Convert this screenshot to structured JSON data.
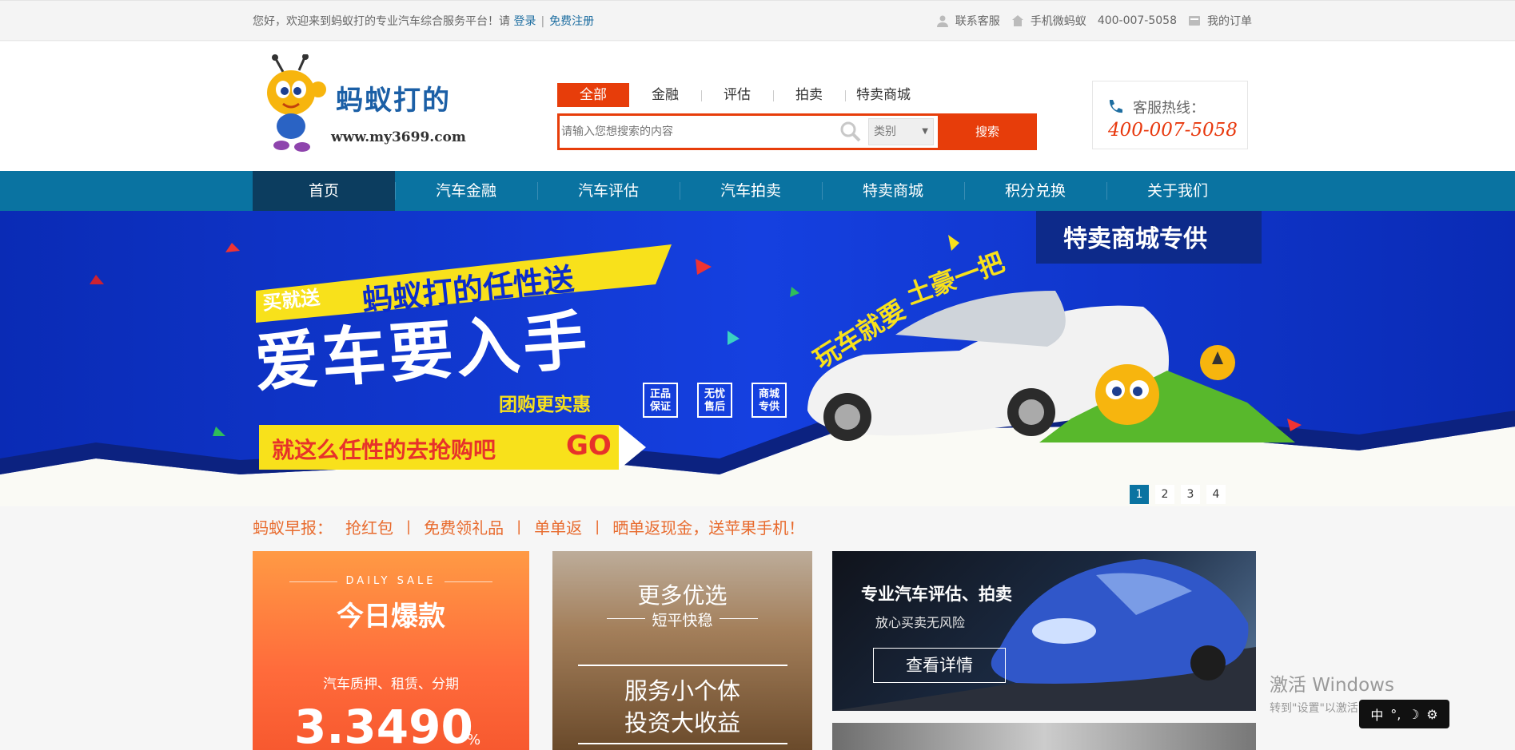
{
  "topbar": {
    "welcome": "您好，欢迎来到蚂蚁打的专业汽车综合服务平台！请",
    "login": "登录",
    "register": "免费注册",
    "service": "联系客服",
    "mobile": "手机微蚂蚁",
    "phone": "400-007-5058",
    "orders": "我的订单"
  },
  "logo": {
    "title": "蚂蚁打的",
    "url": "www.my3699.com"
  },
  "search": {
    "tabs": [
      "全部",
      "金融",
      "评估",
      "拍卖",
      "特卖商城"
    ],
    "placeholder": "请输入您想搜索的内容",
    "category": "类别",
    "submit": "搜索"
  },
  "hotline": {
    "label": "客服热线：",
    "number": "400-007-5058"
  },
  "nav": [
    "首页",
    "汽车金融",
    "汽车评估",
    "汽车拍卖",
    "特卖商城",
    "积分兑换",
    "关于我们"
  ],
  "banner": {
    "corner": "特卖商城专供",
    "tag_buy": "买就送",
    "tag_title": "蚂蚁打的任性送",
    "headline": "爱车要入手",
    "slogan": "团购更实惠",
    "badges": [
      "正品保证",
      "无忧售后",
      "商城专供"
    ],
    "cta": "就这么任性的去抢购吧",
    "go": "GO",
    "side_1": "玩车就要",
    "side_2": "土豪一把",
    "pages": [
      "1",
      "2",
      "3",
      "4"
    ]
  },
  "news": {
    "label": "蚂蚁早报：",
    "items": [
      "抢红包",
      "免费领礼品",
      "单单返",
      "晒单返现金，送苹果手机！"
    ]
  },
  "cards": {
    "daily": {
      "en": "DAILY SALE",
      "title": "今日爆款",
      "sub": "汽车质押、租赁、分期",
      "rate": "3.3490",
      "unit": "%"
    },
    "more": {
      "title": "更多优选",
      "sub": "短平快稳",
      "line1": "服务小个体",
      "line2": "投资大收益"
    },
    "car": {
      "title": "专业汽车评估、拍卖",
      "sub": "放心买卖无风险",
      "button": "查看详情"
    }
  },
  "os": {
    "activate": "激活 Windows",
    "hint": "转到\"设置\"以激活 Windows。",
    "ime": "中"
  },
  "colors": {
    "brand": "#e73d0a",
    "nav": "#0a73a1",
    "navActive": "#0c3d5f",
    "banner": "#0b2ccd"
  }
}
